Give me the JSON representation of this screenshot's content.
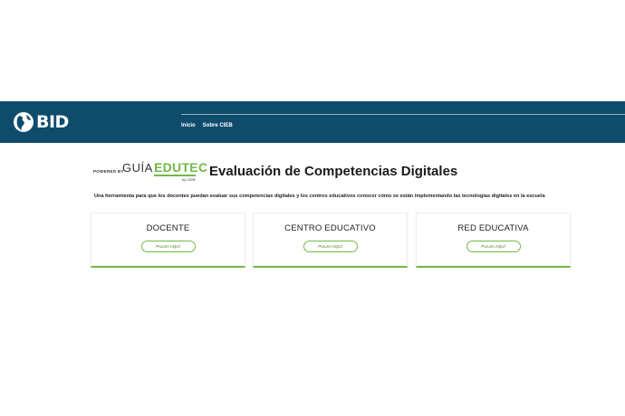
{
  "header": {
    "logo_text": "BID",
    "nav": [
      {
        "label": "Inicio"
      },
      {
        "label": "Sobre CIEB"
      }
    ]
  },
  "brand": {
    "powered_by": "POWERED BY",
    "guia": "GUÍA",
    "edutec": "EDUTEC",
    "by": "by CIEB",
    "accent_color": "#72b845"
  },
  "main": {
    "title": "Evaluación de Competencias Digitales",
    "subtitle": "Una herramienta para que los docentes puedan evaluar sus competencias digitales y los centros educativos conocer cómo se están implementando las tecnologías digitales en la escuela",
    "cards": [
      {
        "title": "DOCENTE",
        "button": "PULSA AQUÍ"
      },
      {
        "title": "CENTRO EDUCATIVO",
        "button": "PULSA AQUÍ"
      },
      {
        "title": "RED EDUCATIVA",
        "button": "PULSA AQUÍ"
      }
    ]
  },
  "colors": {
    "header_bg": "#0f4c6c"
  }
}
